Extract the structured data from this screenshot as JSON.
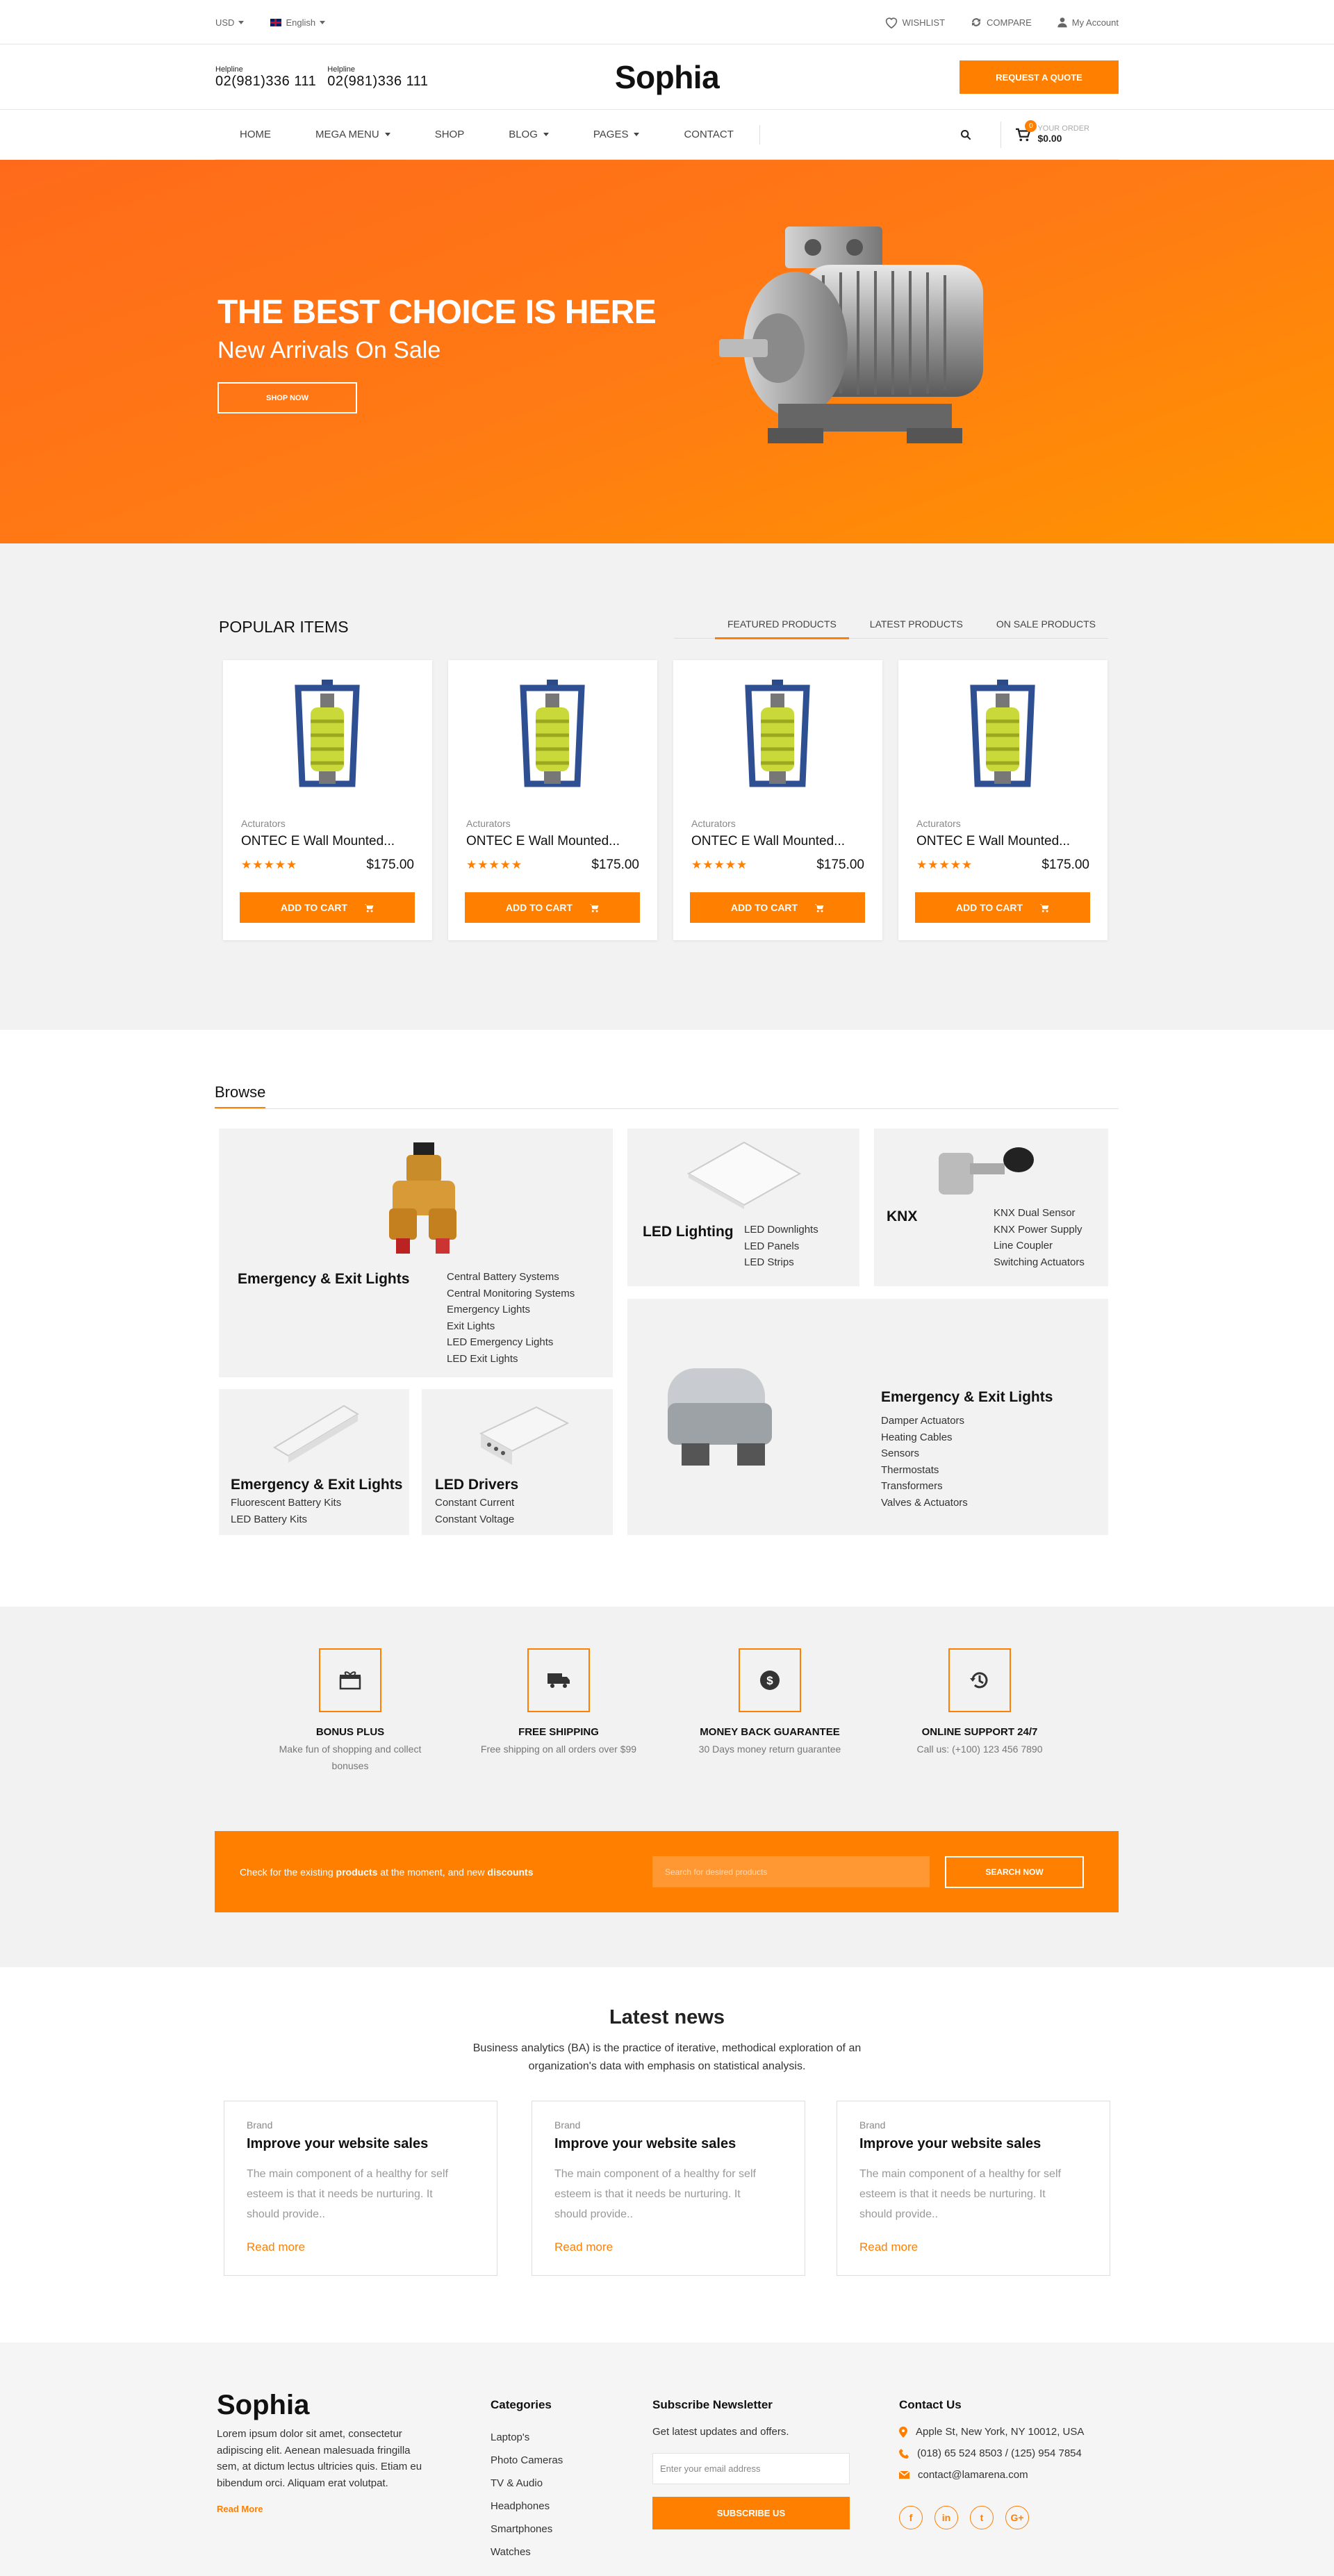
{
  "topbar": {
    "currency": "USD",
    "language": "English",
    "wishlist": "WISHLIST",
    "compare": "COMPARE",
    "account": "My Account"
  },
  "header": {
    "helplines": [
      {
        "label": "Helpline",
        "number": "02(981)336 111"
      },
      {
        "label": "Helpline",
        "number": "02(981)336 111"
      }
    ],
    "logo": "Sophia",
    "quote_button": "REQUEST A QUOTE"
  },
  "nav": {
    "items": [
      "HOME",
      "MEGA MENU",
      "SHOP",
      "BLOG",
      "PAGES",
      "CONTACT"
    ],
    "cart": {
      "count": "0",
      "label": "YOUR ORDER",
      "total": "$0.00"
    }
  },
  "hero": {
    "title": "THE BEST CHOICE IS HERE",
    "subtitle": "New Arrivals On Sale",
    "button": "SHOP NOW"
  },
  "popular": {
    "title": "POPULAR ITEMS",
    "tabs": [
      "FEATURED PRODUCTS",
      "LATEST PRODUCTS",
      "ON SALE PRODUCTS"
    ],
    "products": [
      {
        "category": "Acturators",
        "name": "ONTEC E Wall Mounted...",
        "stars": "★★★★★",
        "price": "$175.00",
        "button": "ADD TO CART"
      },
      {
        "category": "Acturators",
        "name": "ONTEC E Wall Mounted...",
        "stars": "★★★★★",
        "price": "$175.00",
        "button": "ADD TO CART"
      },
      {
        "category": "Acturators",
        "name": "ONTEC E Wall Mounted...",
        "stars": "★★★★★",
        "price": "$175.00",
        "button": "ADD TO CART"
      },
      {
        "category": "Acturators",
        "name": "ONTEC E Wall Mounted...",
        "stars": "★★★★★",
        "price": "$175.00",
        "button": "ADD TO CART"
      }
    ]
  },
  "browse": {
    "title": "Browse",
    "tiles": [
      {
        "title": "Emergency & Exit Lights",
        "items": [
          "Central Battery Systems",
          "Central Monitoring Systems",
          "Emergency Lights",
          "Exit Lights",
          "LED Emergency Lights",
          "LED Exit Lights"
        ]
      },
      {
        "title": "LED Lighting",
        "items": [
          "LED Downlights",
          "LED Panels",
          "LED Strips"
        ]
      },
      {
        "title": "KNX",
        "items": [
          "KNX Dual Sensor",
          "KNX Power Supply",
          "Line Coupler",
          "Switching Actuators"
        ]
      },
      {
        "title": "Emergency & Exit Lights",
        "items": [
          "Damper Actuators",
          "Heating Cables",
          "Sensors",
          "Thermostats",
          "Transformers",
          "Valves & Actuators"
        ]
      },
      {
        "title": "Emergency & Exit Lights",
        "items": [
          "Fluorescent Battery Kits",
          "LED Battery Kits"
        ]
      },
      {
        "title": "LED Drivers",
        "items": [
          "Constant Current",
          "Constant Voltage"
        ]
      }
    ]
  },
  "features": [
    {
      "icon": "gift-icon",
      "title": "BONUS PLUS",
      "text": "Make fun of shopping and collect bonuses"
    },
    {
      "icon": "truck-icon",
      "title": "FREE SHIPPING",
      "text": "Free shipping on all orders over $99"
    },
    {
      "icon": "dollar-icon",
      "title": "MONEY BACK GUARANTEE",
      "text": "30 Days money return guarantee"
    },
    {
      "icon": "history-icon",
      "title": "ONLINE SUPPORT 24/7",
      "text": "Call us: (+100) 123 456 7890"
    }
  ],
  "promo": {
    "text_a": "Check for the existing ",
    "text_b": "products",
    "text_c": " at the moment, and new ",
    "text_d": "discounts",
    "placeholder": "Search for desired products",
    "button": "SEARCH NOW"
  },
  "news": {
    "title": "Latest news",
    "subtitle": "Business analytics (BA) is the practice of iterative, methodical exploration of an organization's data with emphasis on statistical analysis.",
    "posts": [
      {
        "brand": "Brand",
        "title": "Improve your website sales",
        "excerpt": "The main component of a healthy for self esteem is that it needs be nurturing. It should provide..",
        "link": "Read more"
      },
      {
        "brand": "Brand",
        "title": "Improve your website sales",
        "excerpt": "The main component of a healthy for self esteem is that it needs be nurturing. It should provide..",
        "link": "Read more"
      },
      {
        "brand": "Brand",
        "title": "Improve your website sales",
        "excerpt": "The main component of a healthy for self esteem is that it needs be nurturing. It should provide..",
        "link": "Read more"
      }
    ]
  },
  "footer": {
    "logo": "Sophia",
    "desc": "Lorem ipsum dolor sit amet, consectetur adipiscing elit. Aenean malesuada fringilla sem, at dictum lectus ultricies quis. Etiam eu bibendum orci. Aliquam erat volutpat.",
    "read_more": "Read More",
    "categories": {
      "title": "Categories",
      "items": [
        "Laptop's",
        "Photo Cameras",
        "TV & Audio",
        "Headphones",
        "Smartphones",
        "Watches"
      ]
    },
    "newsletter": {
      "title": "Subscribe Newsletter",
      "text": "Get latest updates and offers.",
      "placeholder": "Enter your email address",
      "button": "SUBSCRIBE US"
    },
    "contact": {
      "title": "Contact Us",
      "address": "Apple St, New York, NY 10012, USA",
      "phone": "(018) 65 524 8503 / (125) 954 7854",
      "email": "contact@lamarena.com"
    },
    "socials": [
      "f",
      "in",
      "t",
      "G+"
    ]
  },
  "colors": {
    "accent": "#ff7f00",
    "light_bg": "#f2f2f2"
  }
}
